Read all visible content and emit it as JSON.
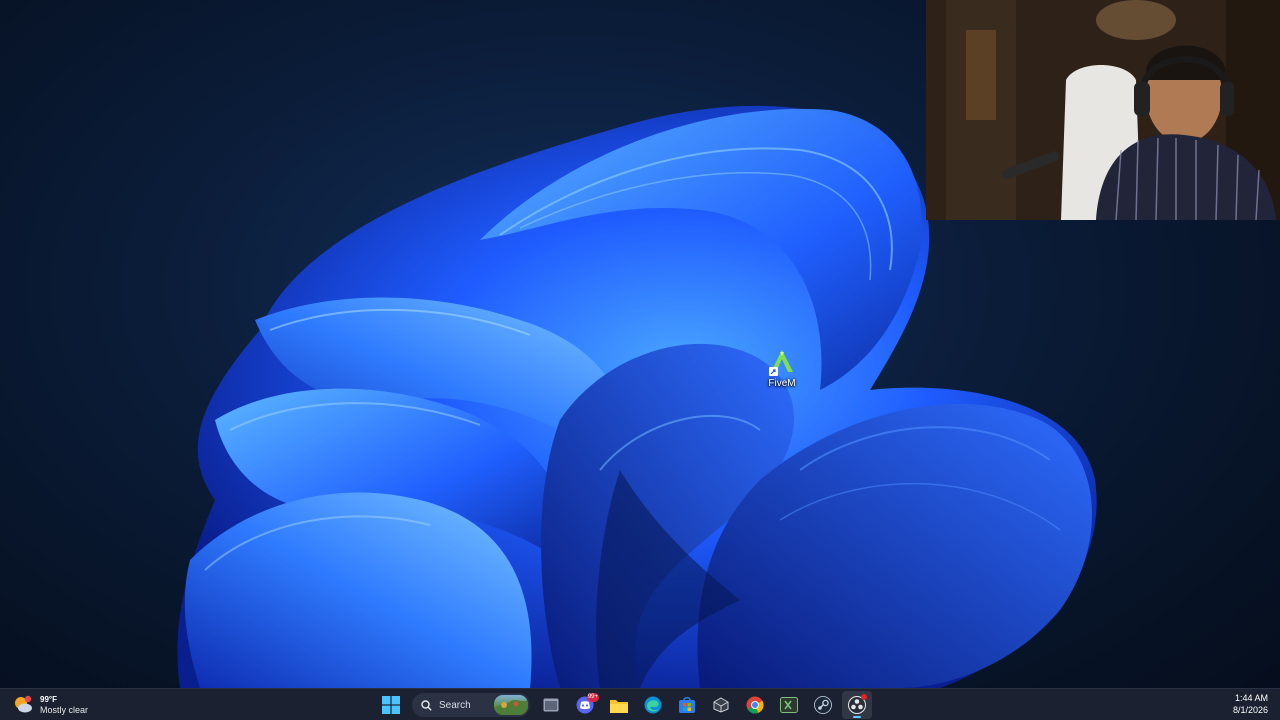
{
  "desktop": {
    "icons": [
      {
        "label": "FiveM"
      }
    ]
  },
  "taskbar": {
    "weather": {
      "temp": "99°F",
      "condition": "Mostly clear",
      "icon": "moon-cloud-icon"
    },
    "search": {
      "label": "Search"
    },
    "apps": [
      {
        "name": "start-button",
        "icon": "windows-logo-icon"
      },
      {
        "name": "file-manager",
        "icon": "window-icon"
      },
      {
        "name": "discord",
        "icon": "discord-icon",
        "badge": "99+"
      },
      {
        "name": "file-explorer",
        "icon": "folder-icon"
      },
      {
        "name": "edge",
        "icon": "edge-icon"
      },
      {
        "name": "store",
        "icon": "store-icon"
      },
      {
        "name": "app-cube",
        "icon": "cube-icon"
      },
      {
        "name": "chrome",
        "icon": "chrome-icon"
      },
      {
        "name": "excel",
        "icon": "spreadsheet-icon"
      },
      {
        "name": "steam",
        "icon": "steam-icon"
      },
      {
        "name": "obs",
        "icon": "record-icon",
        "active": true
      }
    ],
    "clock": {
      "time": "1:44 AM",
      "date": "8/1/2026"
    }
  },
  "colors": {
    "desktop_bg": "#0b1d3a",
    "bloom_blue": "#1f5cff",
    "taskbar_bg": "#1b2130",
    "accent": "#60cdff"
  }
}
